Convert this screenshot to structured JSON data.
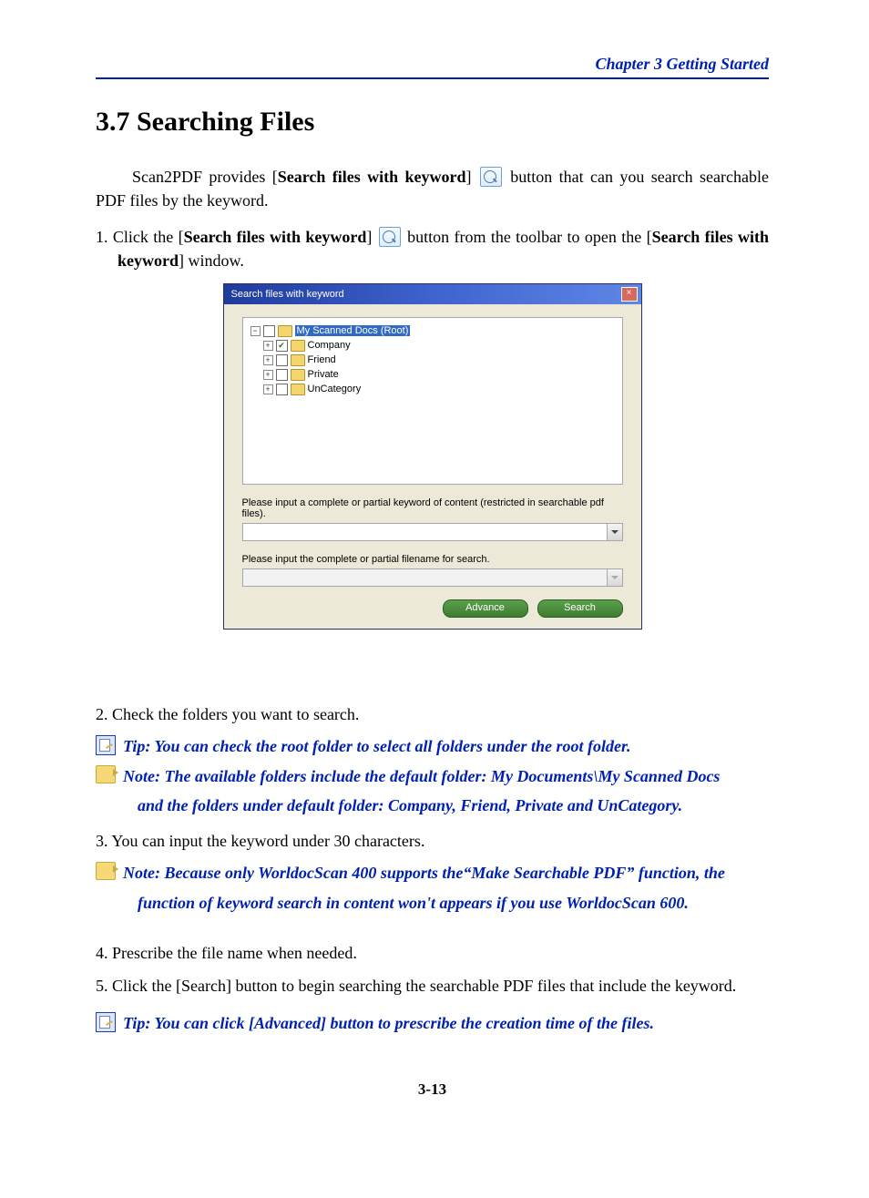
{
  "header": "Chapter 3  Getting Started",
  "section_title": "3.7 Searching Files",
  "intro": {
    "t1": "Scan2PDF provides [",
    "t2": "Search files with keyword",
    "t3": "] ",
    "t4": " button that can you search searchable PDF files by the keyword."
  },
  "step1": {
    "prefix": "1. Click the [",
    "bold1": "Search files with keyword",
    "mid1": "] ",
    "mid2": " button from the toolbar to open the [",
    "bold2": "Search files with keyword",
    "suffix": "] window."
  },
  "dialog": {
    "title": "Search files with keyword",
    "close": "×",
    "tree": {
      "root": "My Scanned Docs (Root)",
      "items": [
        {
          "label": "Company",
          "checked": true
        },
        {
          "label": "Friend",
          "checked": false
        },
        {
          "label": "Private",
          "checked": false
        },
        {
          "label": "UnCategory",
          "checked": false
        }
      ]
    },
    "label_keyword": "Please input a complete or partial keyword of content (restricted in searchable pdf files).",
    "label_filename": "Please input the complete or partial filename for search.",
    "btn_advance": "Advance",
    "btn_search": "Search"
  },
  "step2": "2. Check the folders you want to search.",
  "tip1": "Tip: You can check the root folder to select all folders under the root folder.",
  "note1_line1": "Note: The available folders include the default folder: My Documents\\My Scanned Docs",
  "note1_line2": "and the folders under default folder: Company, Friend, Private and UnCategory.",
  "step3": "3. You can input the keyword under 30 characters.",
  "note2_line1": "Note: Because only WorldocScan 400 supports the“Make Searchable PDF” function,  the",
  "note2_line2": "function of keyword search in content won't appears if you use WorldocScan 600.",
  "step4": "4. Prescribe the file name when needed.",
  "step5": "5. Click the [Search] button to begin searching the searchable PDF files that include the keyword.",
  "tip2": "Tip: You can click [Advanced] button to prescribe the creation time of the files.",
  "page_number": "3-13"
}
